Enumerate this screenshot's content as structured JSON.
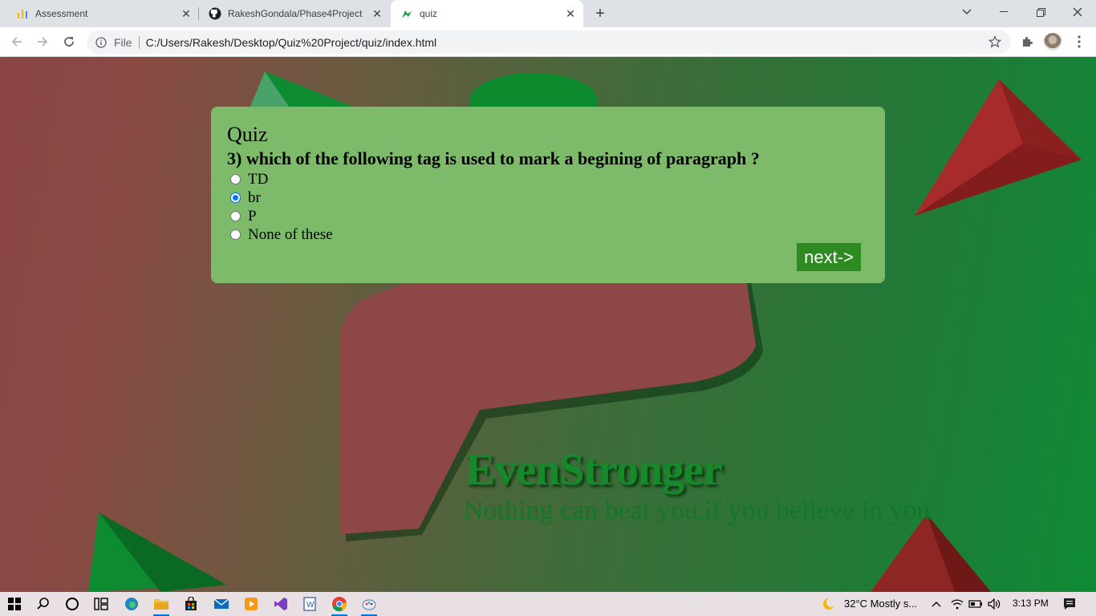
{
  "browser": {
    "tabs": [
      {
        "title": "Assessment",
        "icon": "bar-chart-icon",
        "active": false
      },
      {
        "title": "RakeshGondala/Phase4Project",
        "icon": "github-icon",
        "active": false
      },
      {
        "title": "quiz",
        "icon": "arrow-logo-icon",
        "active": true
      }
    ],
    "address_scheme": "File",
    "address_url": "C:/Users/Rakesh/Desktop/Quiz%20Project/quiz/index.html"
  },
  "quiz": {
    "heading": "Quiz",
    "question": "3) which of the following tag is used to mark a begining of paragraph ?",
    "options": [
      {
        "label": "TD",
        "checked": false
      },
      {
        "label": "br",
        "checked": true
      },
      {
        "label": "P",
        "checked": false
      },
      {
        "label": "None of these",
        "checked": false
      }
    ],
    "next_label": "next->"
  },
  "brand": {
    "title": "EvenStronger",
    "tagline": "Nothing can beat you,if you believe in you"
  },
  "taskbar": {
    "weather": "32°C  Mostly s...",
    "time": "3:13 PM"
  },
  "colors": {
    "card": "#7dbb6b",
    "next_button": "#2e8b22",
    "radio_accent": "#0075ff"
  }
}
